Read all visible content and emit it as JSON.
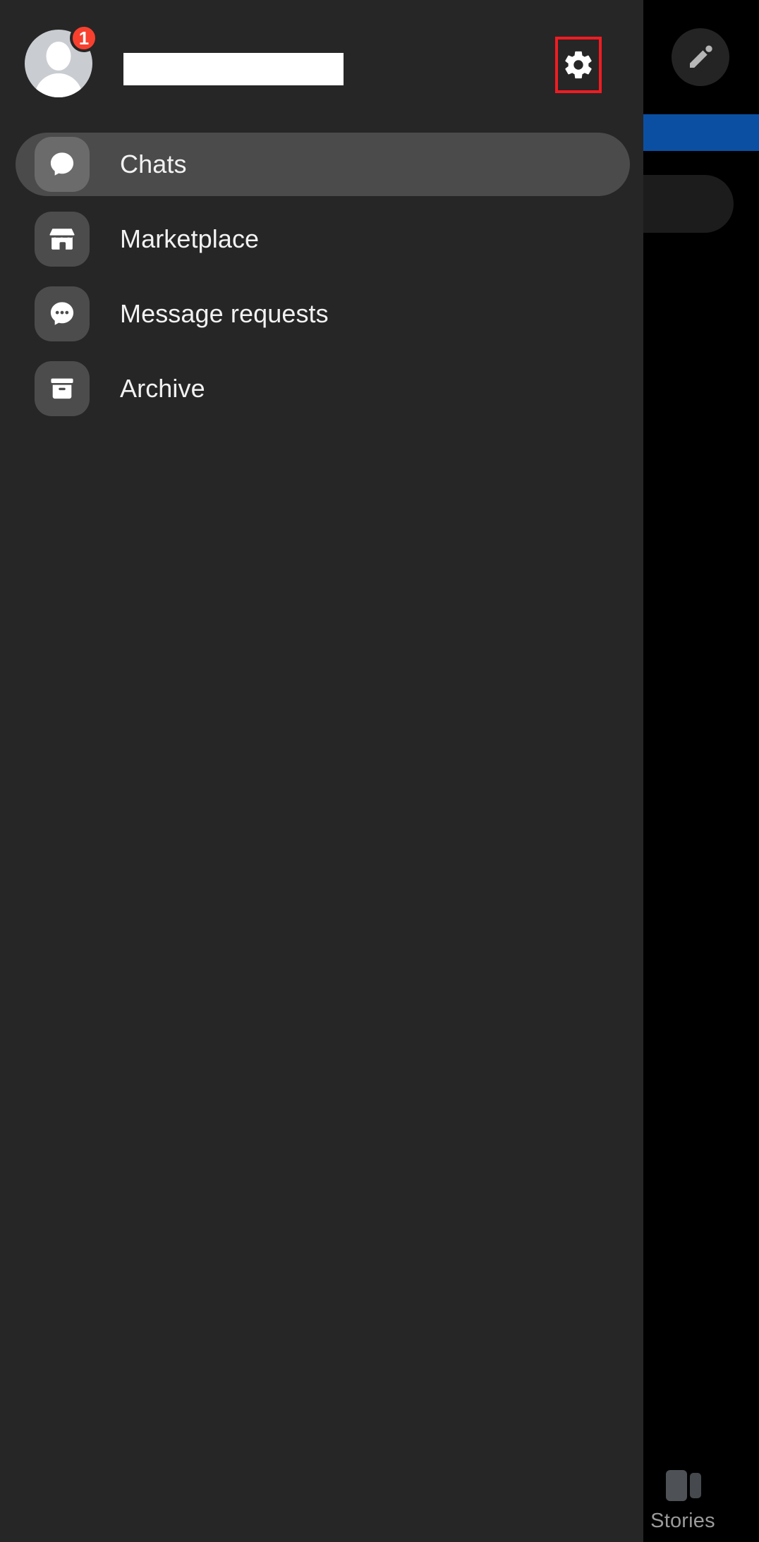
{
  "app": {
    "background_color": "#000000",
    "drawer_background": "#262626"
  },
  "drawer": {
    "header": {
      "avatar_name": "user-avatar",
      "badge_count": "1",
      "badge_color": "#f8402f",
      "name_field_value": "",
      "settings_label": "Settings",
      "settings_highlight_color": "#f01c22"
    },
    "nav_items": [
      {
        "label": "Chats",
        "icon": "chat-bubble-icon",
        "active": true
      },
      {
        "label": "Marketplace",
        "icon": "storefront-icon",
        "active": false
      },
      {
        "label": "Message requests",
        "icon": "chat-bubble-dots-icon",
        "active": false
      },
      {
        "label": "Archive",
        "icon": "archive-box-icon",
        "active": false
      }
    ]
  },
  "background_app": {
    "compose_button_label": "New message",
    "compose_icon": "pencil-icon",
    "banner_color": "#0b4fa3",
    "search_pill_label": "",
    "bottom_tabs": [
      {
        "label": "Stories",
        "icon": "stories-icon"
      }
    ]
  }
}
